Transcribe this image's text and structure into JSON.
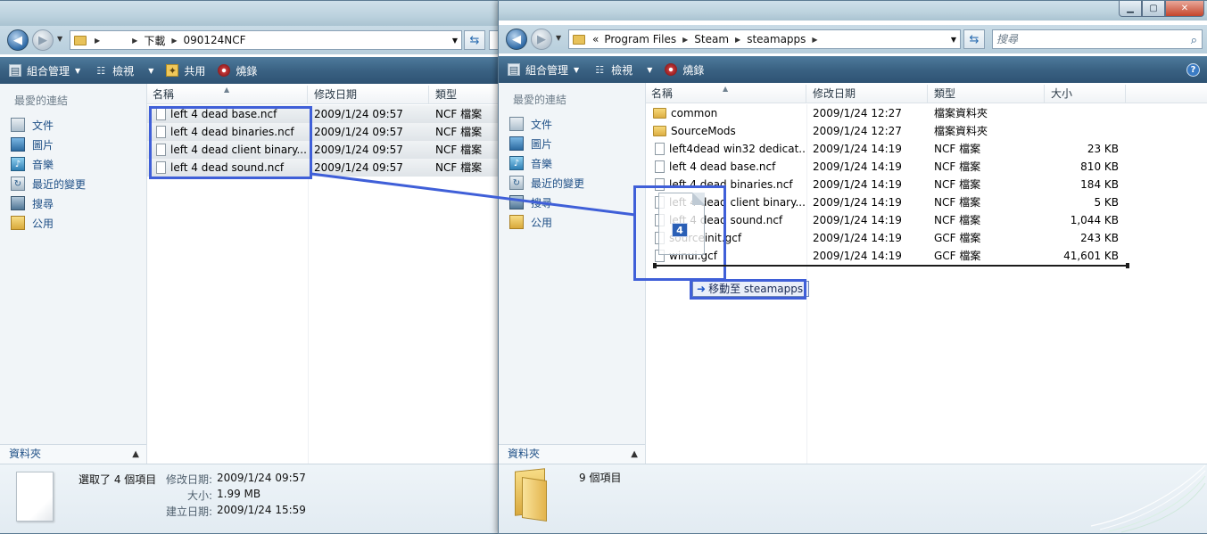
{
  "left": {
    "address": {
      "user": "",
      "downloads": "下載",
      "folder": "090124NCF"
    },
    "toolbar": {
      "organize": "組合管理",
      "views": "檢視",
      "share": "共用",
      "burn": "燒錄"
    },
    "nav": {
      "heading": "最愛的連結",
      "items": [
        "文件",
        "圖片",
        "音樂",
        "最近的變更",
        "搜尋",
        "公用"
      ],
      "folders": "資料夾"
    },
    "columns": {
      "name": "名稱",
      "modified": "修改日期",
      "type": "類型"
    },
    "files": [
      {
        "name": "left 4 dead base.ncf",
        "modified": "2009/1/24 09:57",
        "type": "NCF 檔案"
      },
      {
        "name": "left 4 dead binaries.ncf",
        "modified": "2009/1/24 09:57",
        "type": "NCF 檔案"
      },
      {
        "name": "left 4 dead client binary....",
        "modified": "2009/1/24 09:57",
        "type": "NCF 檔案"
      },
      {
        "name": "left 4 dead sound.ncf",
        "modified": "2009/1/24 09:57",
        "type": "NCF 檔案"
      }
    ],
    "details": {
      "selected": "選取了 4 個項目",
      "modified_label": "修改日期:",
      "modified_value": "2009/1/24 09:57",
      "size_label": "大小:",
      "size_value": "1.99 MB",
      "created_label": "建立日期:",
      "created_value": "2009/1/24 15:59"
    }
  },
  "right": {
    "address": {
      "overflow": "«",
      "seg1": "Program Files",
      "seg2": "Steam",
      "seg3": "steamapps"
    },
    "search_placeholder": "搜尋",
    "toolbar": {
      "organize": "組合管理",
      "views": "檢視",
      "burn": "燒錄",
      "help": "?"
    },
    "nav": {
      "heading": "最愛的連結",
      "items": [
        "文件",
        "圖片",
        "音樂",
        "最近的變更",
        "搜尋",
        "公用"
      ],
      "folders": "資料夾"
    },
    "columns": {
      "name": "名稱",
      "modified": "修改日期",
      "type": "類型",
      "size": "大小"
    },
    "files": [
      {
        "kind": "folder",
        "name": "common",
        "modified": "2009/1/24 12:27",
        "type": "檔案資料夾",
        "size": ""
      },
      {
        "kind": "folder",
        "name": "SourceMods",
        "modified": "2009/1/24 12:27",
        "type": "檔案資料夾",
        "size": ""
      },
      {
        "kind": "file",
        "name": "left4dead win32 dedicat...",
        "modified": "2009/1/24 14:19",
        "type": "NCF 檔案",
        "size": "23 KB"
      },
      {
        "kind": "file",
        "name": "left 4 dead base.ncf",
        "modified": "2009/1/24 14:19",
        "type": "NCF 檔案",
        "size": "810 KB"
      },
      {
        "kind": "file",
        "name": "left 4 dead binaries.ncf",
        "modified": "2009/1/24 14:19",
        "type": "NCF 檔案",
        "size": "184 KB"
      },
      {
        "kind": "file",
        "name": "left 4 dead client binary....",
        "modified": "2009/1/24 14:19",
        "type": "NCF 檔案",
        "size": "5 KB"
      },
      {
        "kind": "file",
        "name": "left 4 dead sound.ncf",
        "modified": "2009/1/24 14:19",
        "type": "NCF 檔案",
        "size": "1,044 KB"
      },
      {
        "kind": "file",
        "name": "sourceinit.gcf",
        "modified": "2009/1/24 14:19",
        "type": "GCF 檔案",
        "size": "243 KB"
      },
      {
        "kind": "file",
        "name": "winui.gcf",
        "modified": "2009/1/24 14:19",
        "type": "GCF 檔案",
        "size": "41,601 KB"
      }
    ],
    "details": {
      "count": "9 個項目"
    }
  },
  "drag": {
    "count": "4",
    "tooltip": "移動至 steamapps"
  },
  "colors": {
    "toolbar": "#3a6283",
    "highlight": "#3f5fd8",
    "link": "#1e4f86"
  }
}
